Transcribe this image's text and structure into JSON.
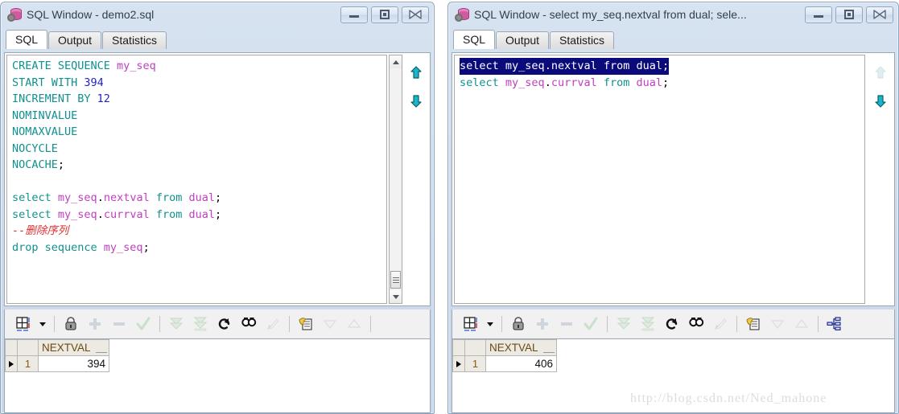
{
  "app": {
    "watermark": "http://blog.csdn.net/Ned_mahone"
  },
  "colors": {
    "keyword": "#10918f",
    "identifier": "#c03fc0",
    "number": "#2222cc",
    "comment": "#e03030",
    "selection_bg": "#0a0a7a",
    "titlebar_bg": "#cfdcec",
    "header_text": "#6b4a10"
  },
  "windows": [
    {
      "id": "left",
      "title": "SQL Window - demo2.sql",
      "icon": "database-gear-icon",
      "buttons": {
        "minimize": "minimize-button",
        "maximize": "maximize-button",
        "close": "close-button"
      },
      "tabs": [
        {
          "label": "SQL",
          "active": true
        },
        {
          "label": "Output",
          "active": false
        },
        {
          "label": "Statistics",
          "active": false
        }
      ],
      "editor": {
        "lines": [
          [
            {
              "t": "CREATE SEQUENCE ",
              "c": "kw"
            },
            {
              "t": "my_seq",
              "c": "id"
            }
          ],
          [
            {
              "t": "START WITH ",
              "c": "kw"
            },
            {
              "t": "394",
              "c": "num"
            }
          ],
          [
            {
              "t": "INCREMENT BY ",
              "c": "kw"
            },
            {
              "t": "12",
              "c": "num"
            }
          ],
          [
            {
              "t": "NOMINVALUE",
              "c": "kw"
            }
          ],
          [
            {
              "t": "NOMAXVALUE",
              "c": "kw"
            }
          ],
          [
            {
              "t": "NOCYCLE",
              "c": "kw"
            }
          ],
          [
            {
              "t": "NOCACHE",
              "c": "kw"
            },
            {
              "t": ";",
              "c": "pl"
            }
          ],
          [
            {
              "t": " ",
              "c": "pl"
            }
          ],
          [
            {
              "t": "select ",
              "c": "kw"
            },
            {
              "t": "my_seq",
              "c": "id"
            },
            {
              "t": ".",
              "c": "pl"
            },
            {
              "t": "nextval",
              "c": "id"
            },
            {
              "t": " from ",
              "c": "kw"
            },
            {
              "t": "dual",
              "c": "id"
            },
            {
              "t": ";",
              "c": "pl"
            }
          ],
          [
            {
              "t": "select ",
              "c": "kw"
            },
            {
              "t": "my_seq",
              "c": "id"
            },
            {
              "t": ".",
              "c": "pl"
            },
            {
              "t": "currval",
              "c": "id"
            },
            {
              "t": " from ",
              "c": "kw"
            },
            {
              "t": "dual",
              "c": "id"
            },
            {
              "t": ";",
              "c": "pl"
            }
          ],
          [
            {
              "t": "--删除序列",
              "c": "cmt"
            }
          ],
          [
            {
              "t": "drop sequence ",
              "c": "kw"
            },
            {
              "t": "my_seq",
              "c": "id"
            },
            {
              "t": ";",
              "c": "pl"
            }
          ]
        ],
        "selected_line_index": -1,
        "scrollbar": {
          "visible": true,
          "thumb_position": "bottom"
        }
      },
      "nav": {
        "up_enabled": true,
        "down_enabled": true
      },
      "toolbar": [
        {
          "name": "grid-layout-icon",
          "enabled": true
        },
        {
          "name": "dropdown-arrow-icon",
          "enabled": true
        },
        {
          "name": "separator",
          "enabled": false
        },
        {
          "name": "lock-icon",
          "enabled": true
        },
        {
          "name": "add-record-icon",
          "enabled": false
        },
        {
          "name": "remove-record-icon",
          "enabled": false
        },
        {
          "name": "post-changes-icon",
          "enabled": false
        },
        {
          "name": "separator",
          "enabled": false
        },
        {
          "name": "fetch-next-page-icon",
          "enabled": false
        },
        {
          "name": "fetch-last-page-icon",
          "enabled": false
        },
        {
          "name": "refresh-icon",
          "enabled": true
        },
        {
          "name": "find-icon",
          "enabled": true
        },
        {
          "name": "clear-filter-icon",
          "enabled": false
        },
        {
          "name": "separator",
          "enabled": false
        },
        {
          "name": "copy-to-clipboard-icon",
          "enabled": true
        },
        {
          "name": "sort-descending-icon",
          "enabled": false
        },
        {
          "name": "sort-ascending-icon",
          "enabled": false
        },
        {
          "name": "separator",
          "enabled": false
        }
      ],
      "result_grid": {
        "columns": [
          "NEXTVAL"
        ],
        "rows": [
          {
            "index": "1",
            "values": [
              "394"
            ]
          }
        ]
      }
    },
    {
      "id": "right",
      "title": "SQL Window - select my_seq.nextval from dual; sele...",
      "icon": "database-gear-icon",
      "buttons": {
        "minimize": "minimize-button",
        "maximize": "maximize-button",
        "close": "close-button"
      },
      "tabs": [
        {
          "label": "SQL",
          "active": true
        },
        {
          "label": "Output",
          "active": false
        },
        {
          "label": "Statistics",
          "active": false
        }
      ],
      "editor": {
        "lines": [
          [
            {
              "t": "select ",
              "c": "kw"
            },
            {
              "t": "my_seq",
              "c": "id"
            },
            {
              "t": ".",
              "c": "pl"
            },
            {
              "t": "nextval",
              "c": "id"
            },
            {
              "t": " from ",
              "c": "kw"
            },
            {
              "t": "dual",
              "c": "id"
            },
            {
              "t": ";",
              "c": "pl"
            }
          ],
          [
            {
              "t": "select ",
              "c": "kw"
            },
            {
              "t": "my_seq",
              "c": "id"
            },
            {
              "t": ".",
              "c": "pl"
            },
            {
              "t": "currval",
              "c": "id"
            },
            {
              "t": " from ",
              "c": "kw"
            },
            {
              "t": "dual",
              "c": "id"
            },
            {
              "t": ";",
              "c": "pl"
            }
          ]
        ],
        "selected_line_index": 0,
        "scrollbar": {
          "visible": false,
          "thumb_position": "none"
        }
      },
      "nav": {
        "up_enabled": false,
        "down_enabled": true
      },
      "toolbar": [
        {
          "name": "grid-layout-icon",
          "enabled": true
        },
        {
          "name": "dropdown-arrow-icon",
          "enabled": true
        },
        {
          "name": "separator",
          "enabled": false
        },
        {
          "name": "lock-icon",
          "enabled": true
        },
        {
          "name": "add-record-icon",
          "enabled": false
        },
        {
          "name": "remove-record-icon",
          "enabled": false
        },
        {
          "name": "post-changes-icon",
          "enabled": false
        },
        {
          "name": "separator",
          "enabled": false
        },
        {
          "name": "fetch-next-page-icon",
          "enabled": false
        },
        {
          "name": "fetch-last-page-icon",
          "enabled": false
        },
        {
          "name": "refresh-icon",
          "enabled": true
        },
        {
          "name": "find-icon",
          "enabled": true
        },
        {
          "name": "clear-filter-icon",
          "enabled": false
        },
        {
          "name": "separator",
          "enabled": false
        },
        {
          "name": "copy-to-clipboard-icon",
          "enabled": true
        },
        {
          "name": "sort-descending-icon",
          "enabled": false
        },
        {
          "name": "sort-ascending-icon",
          "enabled": false
        },
        {
          "name": "separator",
          "enabled": false
        },
        {
          "name": "explain-plan-icon",
          "enabled": true
        }
      ],
      "result_grid": {
        "columns": [
          "NEXTVAL"
        ],
        "rows": [
          {
            "index": "1",
            "values": [
              "406"
            ]
          }
        ]
      }
    }
  ]
}
